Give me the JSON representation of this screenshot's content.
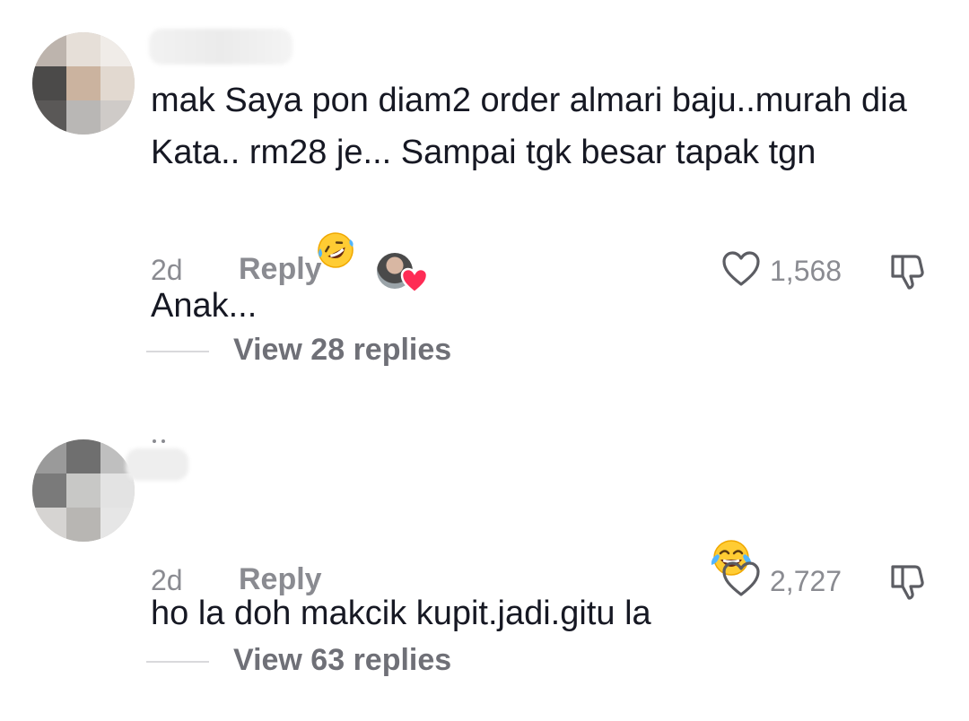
{
  "comments": [
    {
      "text": "mak Saya pon diam2 order almari baju..murah dia Kata.. rm28 je... Sampai tgk besar tapak tgn Anak...",
      "emoji": "rolling-on-floor-laughing",
      "time": "2d",
      "reply_label": "Reply",
      "likes": "1,568",
      "view_replies": "View 28 replies",
      "liked_by_creator": true
    },
    {
      "text": "ho la doh makcik kupit.jadi.gitu la",
      "emoji": "face-with-tears-of-joy",
      "time": "2d",
      "reply_label": "Reply",
      "likes": "2,727",
      "view_replies": "View 63 replies",
      "liked_by_creator": false
    }
  ],
  "icons": {
    "like": "heart-outline-icon",
    "dislike": "thumbs-down-outline-icon",
    "creator_heart": "heart-filled-icon"
  },
  "colors": {
    "text": "#161823",
    "muted": "#8a8b91",
    "heart_red": "#fe2c55"
  }
}
